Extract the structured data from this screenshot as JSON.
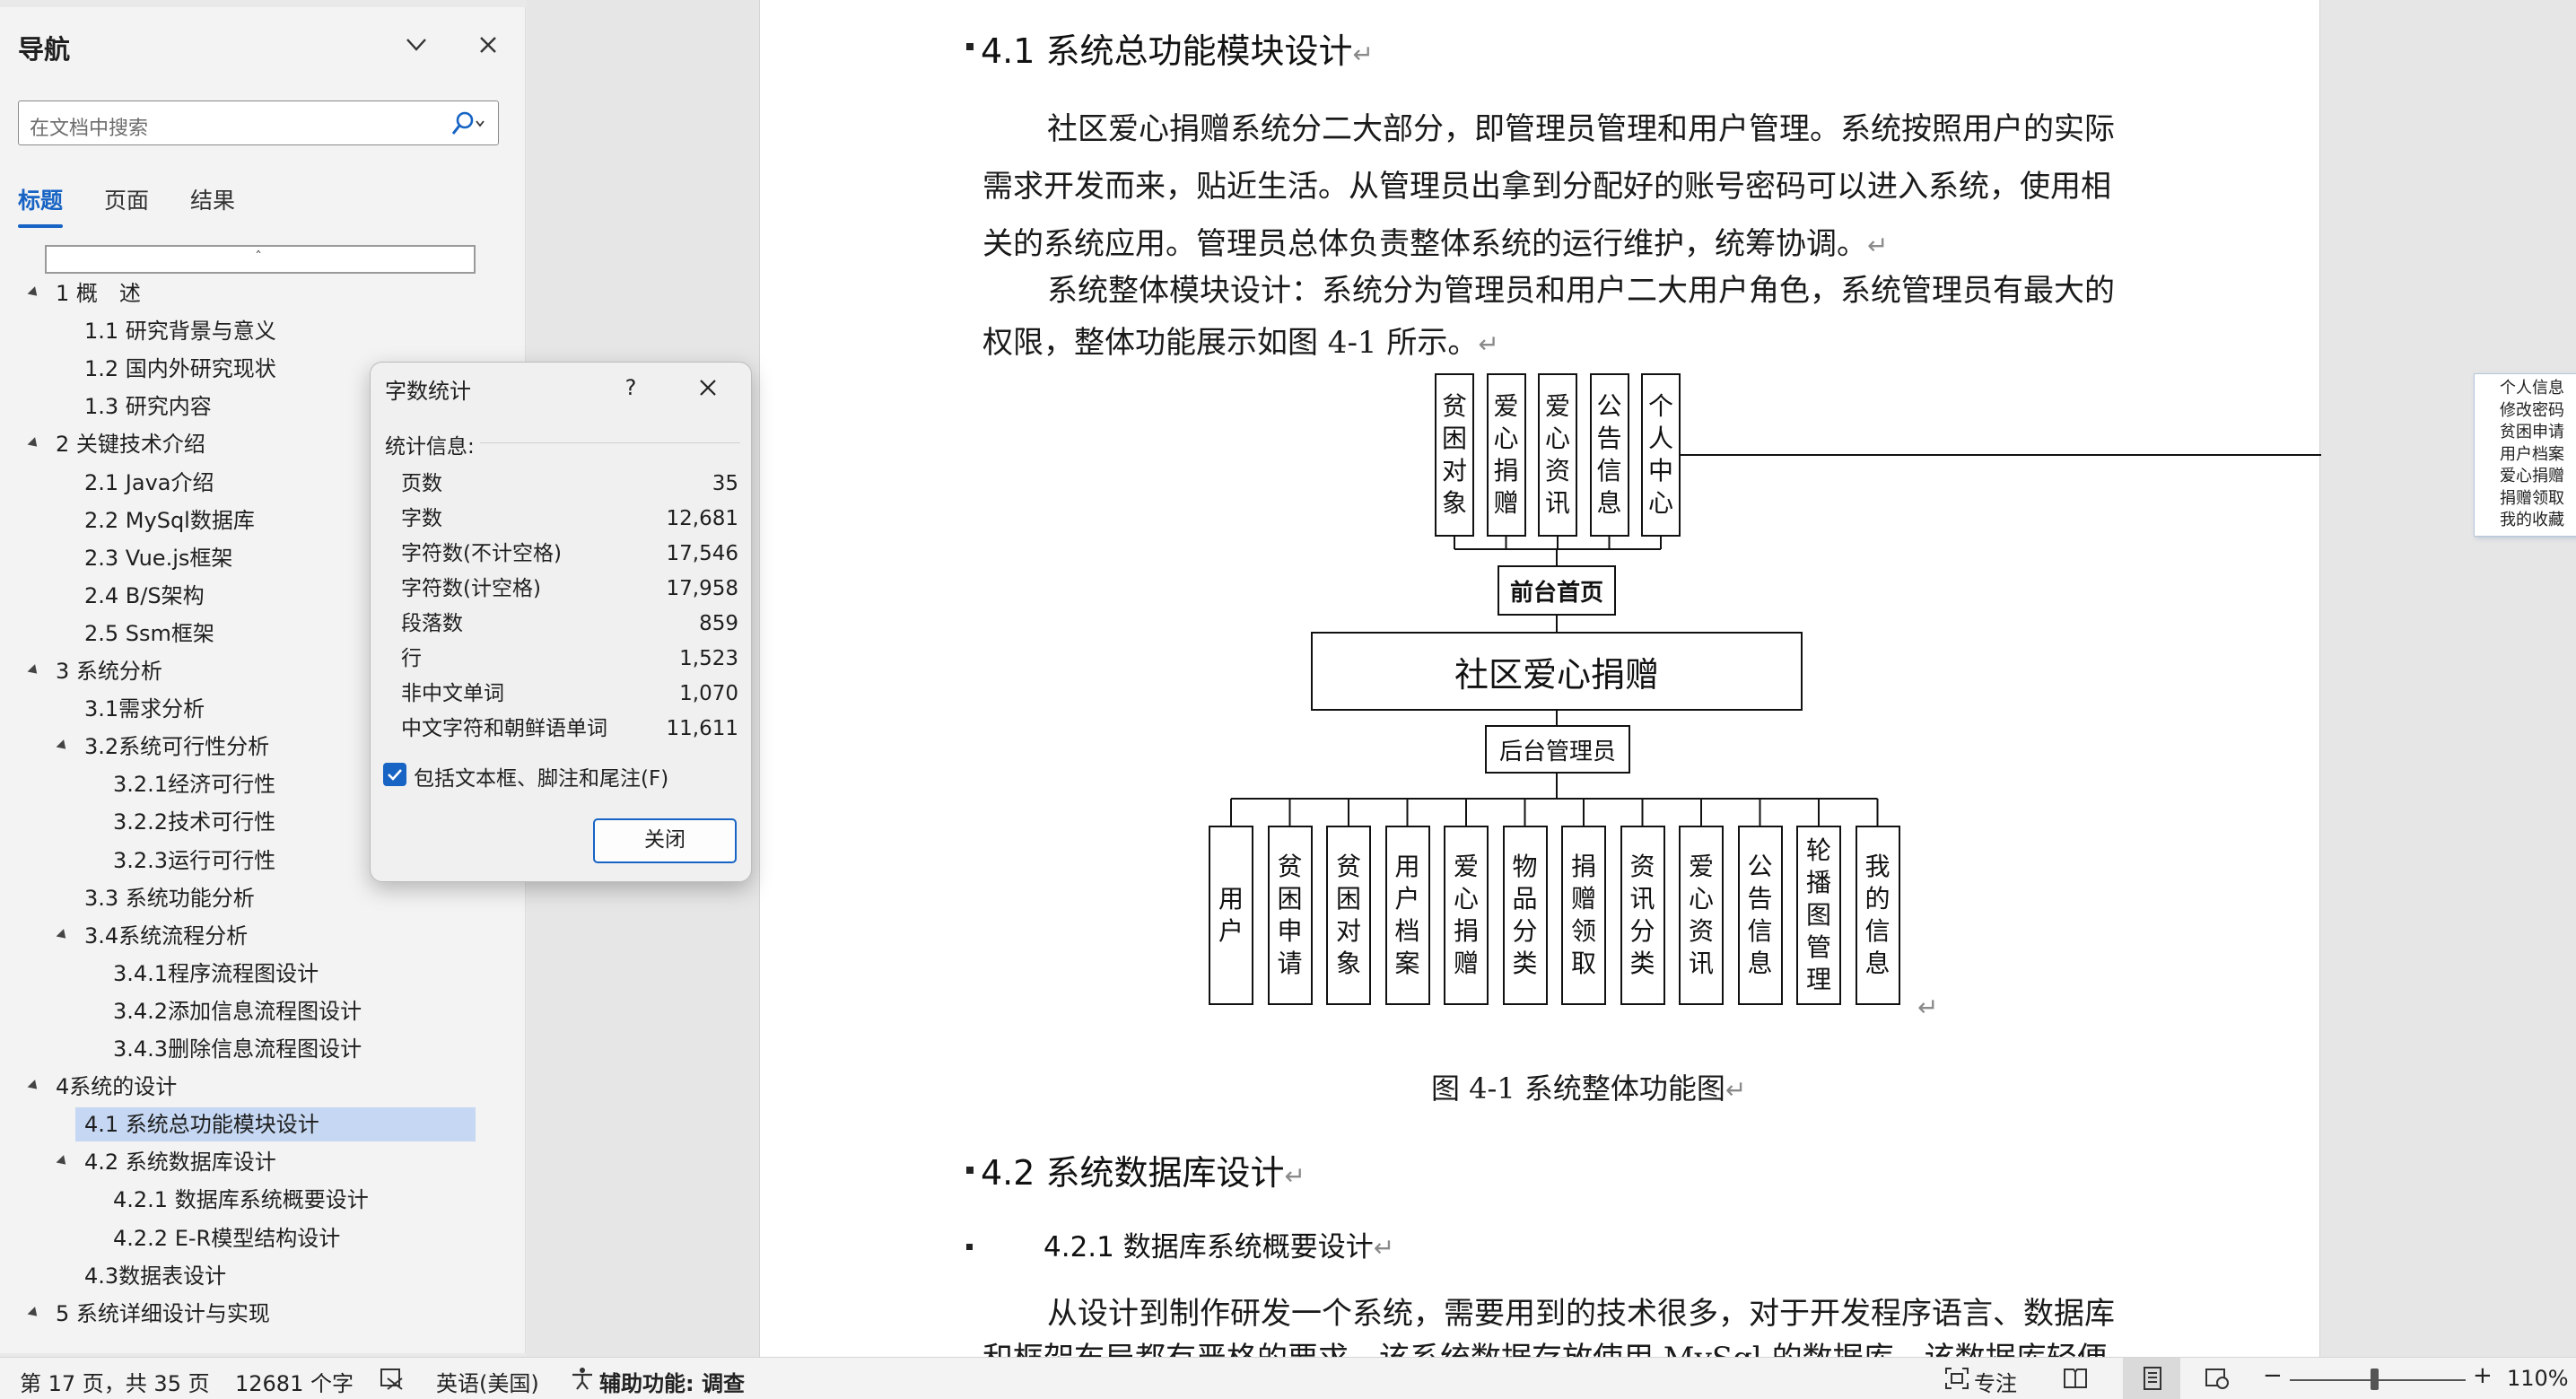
{
  "nav": {
    "title": "导航",
    "search_placeholder": "在文档中搜索",
    "tabs": [
      {
        "label": "标题",
        "active": true
      },
      {
        "label": "页面",
        "active": false
      },
      {
        "label": "结果",
        "active": false
      }
    ],
    "headings": [
      {
        "label": "1 概　述",
        "level": 1,
        "expanded": true
      },
      {
        "label": "1.1 研究背景与意义",
        "level": 2
      },
      {
        "label": "1.2 国内外研究现状",
        "level": 2
      },
      {
        "label": "1.3 研究内容",
        "level": 2
      },
      {
        "label": "2 关键技术介绍",
        "level": 1,
        "expanded": true
      },
      {
        "label": "2.1 Java介绍",
        "level": 2
      },
      {
        "label": "2.2 MySql数据库",
        "level": 2
      },
      {
        "label": "2.3 Vue.js框架",
        "level": 2
      },
      {
        "label": "2.4 B/S架构",
        "level": 2
      },
      {
        "label": "2.5 Ssm框架",
        "level": 2
      },
      {
        "label": "3 系统分析",
        "level": 1,
        "expanded": true
      },
      {
        "label": "3.1需求分析",
        "level": 2
      },
      {
        "label": "3.2系统可行性分析",
        "level": 2,
        "expanded": true
      },
      {
        "label": "3.2.1经济可行性",
        "level": 3
      },
      {
        "label": "3.2.2技术可行性",
        "level": 3
      },
      {
        "label": "3.2.3运行可行性",
        "level": 3
      },
      {
        "label": "3.3 系统功能分析",
        "level": 2
      },
      {
        "label": "3.4系统流程分析",
        "level": 2,
        "expanded": true
      },
      {
        "label": "3.4.1程序流程图设计",
        "level": 3
      },
      {
        "label": "3.4.2添加信息流程图设计",
        "level": 3
      },
      {
        "label": "3.4.3删除信息流程图设计",
        "level": 3
      },
      {
        "label": "4系统的设计",
        "level": 1,
        "expanded": true
      },
      {
        "label": "4.1 系统总功能模块设计",
        "level": 2,
        "selected": true
      },
      {
        "label": "4.2 系统数据库设计",
        "level": 2,
        "expanded": true
      },
      {
        "label": "4.2.1 数据库系统概要设计",
        "level": 3
      },
      {
        "label": "4.2.2 E-R模型结构设计",
        "level": 3
      },
      {
        "label": "4.3数据表设计",
        "level": 2
      },
      {
        "label": "5 系统详细设计与实现",
        "level": 1,
        "expanded": true
      }
    ]
  },
  "dialog": {
    "title": "字数统计",
    "help": "?",
    "section": "统计信息:",
    "stats": [
      {
        "label": "页数",
        "value": "35"
      },
      {
        "label": "字数",
        "value": "12,681"
      },
      {
        "label": "字符数(不计空格)",
        "value": "17,546"
      },
      {
        "label": "字符数(计空格)",
        "value": "17,958"
      },
      {
        "label": "段落数",
        "value": "859"
      },
      {
        "label": "行",
        "value": "1,523"
      },
      {
        "label": "非中文单词",
        "value": "1,070"
      },
      {
        "label": "中文字符和朝鲜语单词",
        "value": "11,611"
      }
    ],
    "checkbox_label": "包括文本框、脚注和尾注(F)",
    "checkbox_checked": true,
    "close_button": "关闭"
  },
  "document": {
    "h41": "4.1  系统总功能模块设计",
    "p1_lines": [
      "社区爱心捐赠系统分二大部分，即管理员管理和用户管理。系统按照用户的实际",
      "需求开发而来，贴近生活。从管理员出拿到分配好的账号密码可以进入系统，使用相",
      "关的系统应用。管理员总体负责整体系统的运行维护，统筹协调。"
    ],
    "p2_lines": [
      "系统整体模块设计：系统分为管理员和用户二大用户角色，系统管理员有最大的",
      "权限，整体功能展示如图 4-1 所示。"
    ],
    "diagram": {
      "front_modules": [
        "贫困对象",
        "爱心捐赠",
        "爱心资讯",
        "公告信息",
        "个人中心"
      ],
      "personal_center_items": [
        "个人信息",
        "修改密码",
        "贫困申请",
        "用户档案",
        "爱心捐赠",
        "捐赠领取",
        "我的收藏"
      ],
      "front_home": "前台首页",
      "system": "社区爱心捐赠",
      "admin": "后台管理员",
      "admin_modules": [
        "用户",
        "贫困申请",
        "贫困对象",
        "用户档案",
        "爱心捐赠",
        "物品分类",
        "捐赠领取",
        "资讯分类",
        "爱心资讯",
        "公告信息",
        "轮播图管理",
        "我的信息"
      ]
    },
    "figure_caption": "图 4-1  系统整体功能图",
    "h42": "4.2  系统数据库设计",
    "h421": "4.2.1  数据库系统概要设计",
    "p3_lines": [
      "从设计到制作研发一个系统，需要用到的技术很多，对于开发程序语言、数据库",
      "和框架布局都有严格的要求。该系统数据存放使用 MySql 的数据库，该数据库轻便"
    ]
  },
  "statusbar": {
    "page": "第 17 页，共 35 页",
    "words": "12681 个字",
    "language": "英语(美国)",
    "accessibility": "辅助功能: 调查",
    "focus": "专注",
    "zoom": "110%",
    "zoom_fraction": 0.48
  }
}
